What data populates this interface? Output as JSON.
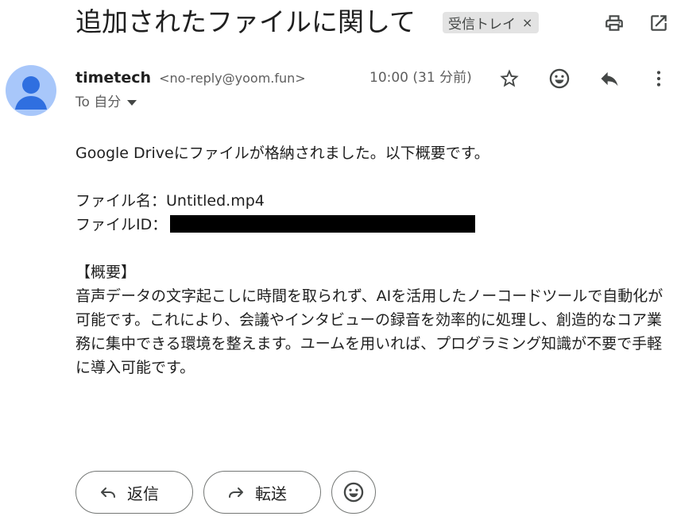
{
  "subject": "追加されたファイルに関して",
  "label_chip": {
    "text": "受信トレイ",
    "close": "×"
  },
  "sender": {
    "name": "timetech",
    "email": "<no-reply@yoom.fun>"
  },
  "time": "10:00 (31 分前)",
  "recipient": "To 自分",
  "body": {
    "intro": "Google Driveにファイルが格納されました。以下概要です。",
    "file_name": "ファイル名：Untitled.mp4",
    "file_id_label": "ファイルID：",
    "summary_heading": "【概要】",
    "summary_text": "音声データの文字起こしに時間を取られず、AIを活用したノーコードツールで自動化が可能です。これにより、会議やインタビューの録音を効率的に処理し、創造的なコア業務に集中できる環境を整えます。ユームを用いれば、プログラミング知識が不要で手軽に導入可能です。"
  },
  "actions": {
    "reply": "返信",
    "forward": "転送"
  },
  "icons": [
    "print-icon",
    "open-in-new-icon",
    "star-icon",
    "emoji-icon",
    "reply-icon",
    "more-vert-icon"
  ]
}
